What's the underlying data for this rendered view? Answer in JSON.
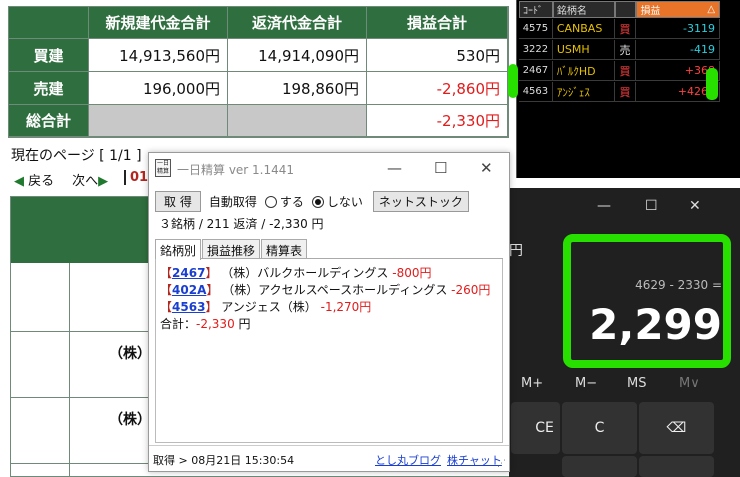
{
  "summary": {
    "headers": [
      "新規建代金合計",
      "返済代金合計",
      "損益合計"
    ],
    "rows": [
      {
        "label": "買建",
        "new_total": "14,913,560円",
        "settle_total": "14,914,090円",
        "pl": "530円",
        "pl_negative": false
      },
      {
        "label": "売建",
        "new_total": "196,000円",
        "settle_total": "198,860円",
        "pl": "-2,860円",
        "pl_negative": true
      },
      {
        "label": "総合計",
        "new_total": "",
        "settle_total": "",
        "pl": "-2,330円",
        "pl_negative": true
      }
    ]
  },
  "page_nav": {
    "current_page": "現在のページ [ 1/1 ]",
    "back": "戻る",
    "next": "次へ",
    "page_num": "01"
  },
  "lower_table": {
    "kabu_label": "（株）"
  },
  "ticker": {
    "headers": {
      "code": "ｺｰﾄﾞ",
      "name": "銘柄名",
      "pl": "損益",
      "pl_sort": "△"
    },
    "rows": [
      {
        "code": "4575",
        "name": "CANBAS",
        "side": "買",
        "pl": "-3119",
        "pl_color": "#29d0e0"
      },
      {
        "code": "3222",
        "name": "USMH",
        "side": "売",
        "pl": "-419",
        "pl_color": "#29d0e0"
      },
      {
        "code": "2467",
        "name": "ﾊﾞﾙｸHD",
        "side": "買",
        "pl": "+368",
        "pl_color": "#ff4040"
      },
      {
        "code": "4563",
        "name": "ｱﾝｼﾞｪｽ",
        "side": "買",
        "pl": "+4261",
        "pl_color": "#ff4040"
      }
    ]
  },
  "calculator": {
    "yen_partial": "円",
    "expression": "4629 - 2330 =",
    "result": "2,299",
    "memory_buttons": [
      "M+",
      "M−",
      "MS",
      "M∨"
    ],
    "buttons": {
      "ce": "CE",
      "c": "C",
      "backspace": "⌫"
    }
  },
  "popup": {
    "icon_text_top": "一日",
    "icon_text_bottom": "精算",
    "title": "一日精算 ver 1.1441",
    "get_button": "取 得",
    "auto_get_label": "自動取得",
    "radio_on": "する",
    "radio_off": "しない",
    "radio_selected": "しない",
    "netstock_button": "ネットストック",
    "summary_line": "３銘柄 / 211 返済 / -2,330 円",
    "tabs": [
      "銘柄別",
      "損益推移",
      "精算表"
    ],
    "active_tab": "銘柄別",
    "entries": [
      {
        "code": "2467",
        "name": "（株）バルクホールディングス",
        "pl": "-800円"
      },
      {
        "code": "402A",
        "name": "（株）アクセルスペースホールディングス",
        "pl": "-260円"
      },
      {
        "code": "4563",
        "name": "アンジェス（株）",
        "pl": "-1,270円"
      }
    ],
    "total_label": "合計：",
    "total_value": "-2,330",
    "total_unit": "円",
    "status_left": "取得 > 08月21日 15:30:54",
    "link_blog": "とし丸ブログ",
    "link_chart": "株チャット"
  }
}
